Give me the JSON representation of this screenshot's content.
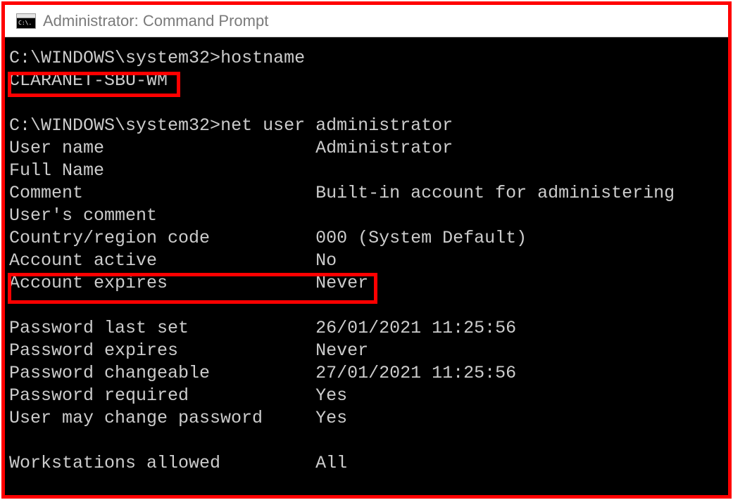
{
  "window": {
    "icon_text": "C:\\.",
    "title": "Administrator: Command Prompt"
  },
  "term": {
    "prompt1_path": "C:\\WINDOWS\\system32>",
    "cmd1": "hostname",
    "hostname_output": "CLARANET-SBU-WM",
    "prompt2_path": "C:\\WINDOWS\\system32>",
    "cmd2": "net user administrator",
    "rows": {
      "user_name_label": "User name",
      "user_name_value": "Administrator",
      "full_name_label": "Full Name",
      "full_name_value": "",
      "comment_label": "Comment",
      "comment_value": "Built-in account for administering",
      "users_comment_label": "User's comment",
      "users_comment_value": "",
      "country_label": "Country/region code",
      "country_value": "000 (System Default)",
      "account_active_label": "Account active",
      "account_active_value": "No",
      "account_expires_label": "Account expires",
      "account_expires_value": "Never",
      "pwd_last_set_label": "Password last set",
      "pwd_last_set_value": "26/01/2021 11:25:56",
      "pwd_expires_label": "Password expires",
      "pwd_expires_value": "Never",
      "pwd_changeable_label": "Password changeable",
      "pwd_changeable_value": "27/01/2021 11:25:56",
      "pwd_required_label": "Password required",
      "pwd_required_value": "Yes",
      "user_may_change_label": "User may change password",
      "user_may_change_value": "Yes",
      "workstations_label": "Workstations allowed",
      "workstations_value": "All"
    }
  }
}
